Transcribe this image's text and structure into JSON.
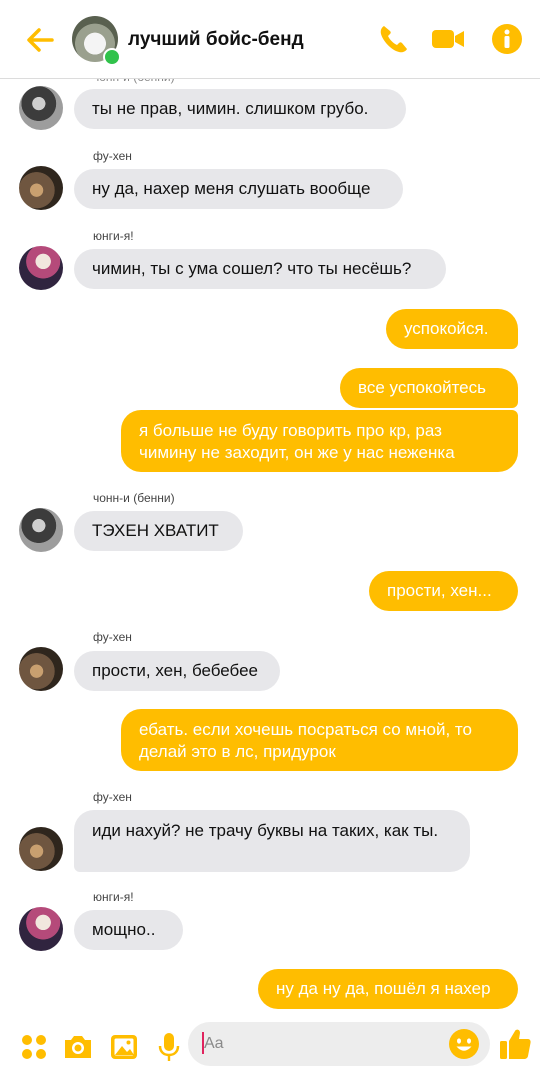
{
  "header": {
    "title": "лучший бойс-бенд"
  },
  "messages": {
    "m1": {
      "sender_clipped": "чонн-и (бенни)",
      "text": "ты не прав, чимин. слишком грубо."
    },
    "m2": {
      "sender": "фу-хен",
      "text": "ну да, нахер меня слушать вообще"
    },
    "m3": {
      "sender": "юнги-я!",
      "text": "чимин, ты с ума сошел? что ты несёшь?"
    },
    "m4": {
      "text": "успокойся."
    },
    "m5": {
      "text": "все успокойтесь"
    },
    "m6": {
      "text": "я больше не буду говорить про кр, раз чимину не заходит, он же у нас неженка"
    },
    "m7": {
      "sender": "чонн-и (бенни)",
      "text": "ТЭХЕН ХВАТИТ"
    },
    "m8": {
      "text": "прости, хен..."
    },
    "m9": {
      "sender": "фу-хен",
      "text": "прости, хен, бебебее"
    },
    "m10": {
      "text": "ебать. если хочешь посраться со мной, то делай это в лс, придурок"
    },
    "m11": {
      "sender": "фу-хен",
      "text": "иди нахуй? не трачу буквы на таких, как ты."
    },
    "m12": {
      "sender": "юнги-я!",
      "text": "мощно.."
    },
    "m13": {
      "text": "ну да ну да, пошёл я нахер"
    }
  },
  "composer": {
    "placeholder": "Aa"
  },
  "colors": {
    "accent": "#ffbd00",
    "incoming_bubble": "#e7e7ea",
    "online": "#31c24b"
  },
  "icons": [
    "back-arrow-icon",
    "phone-icon",
    "video-camera-icon",
    "info-icon",
    "apps-grid-icon",
    "camera-icon",
    "photo-icon",
    "microphone-icon",
    "emoji-icon",
    "thumbs-up-icon"
  ]
}
